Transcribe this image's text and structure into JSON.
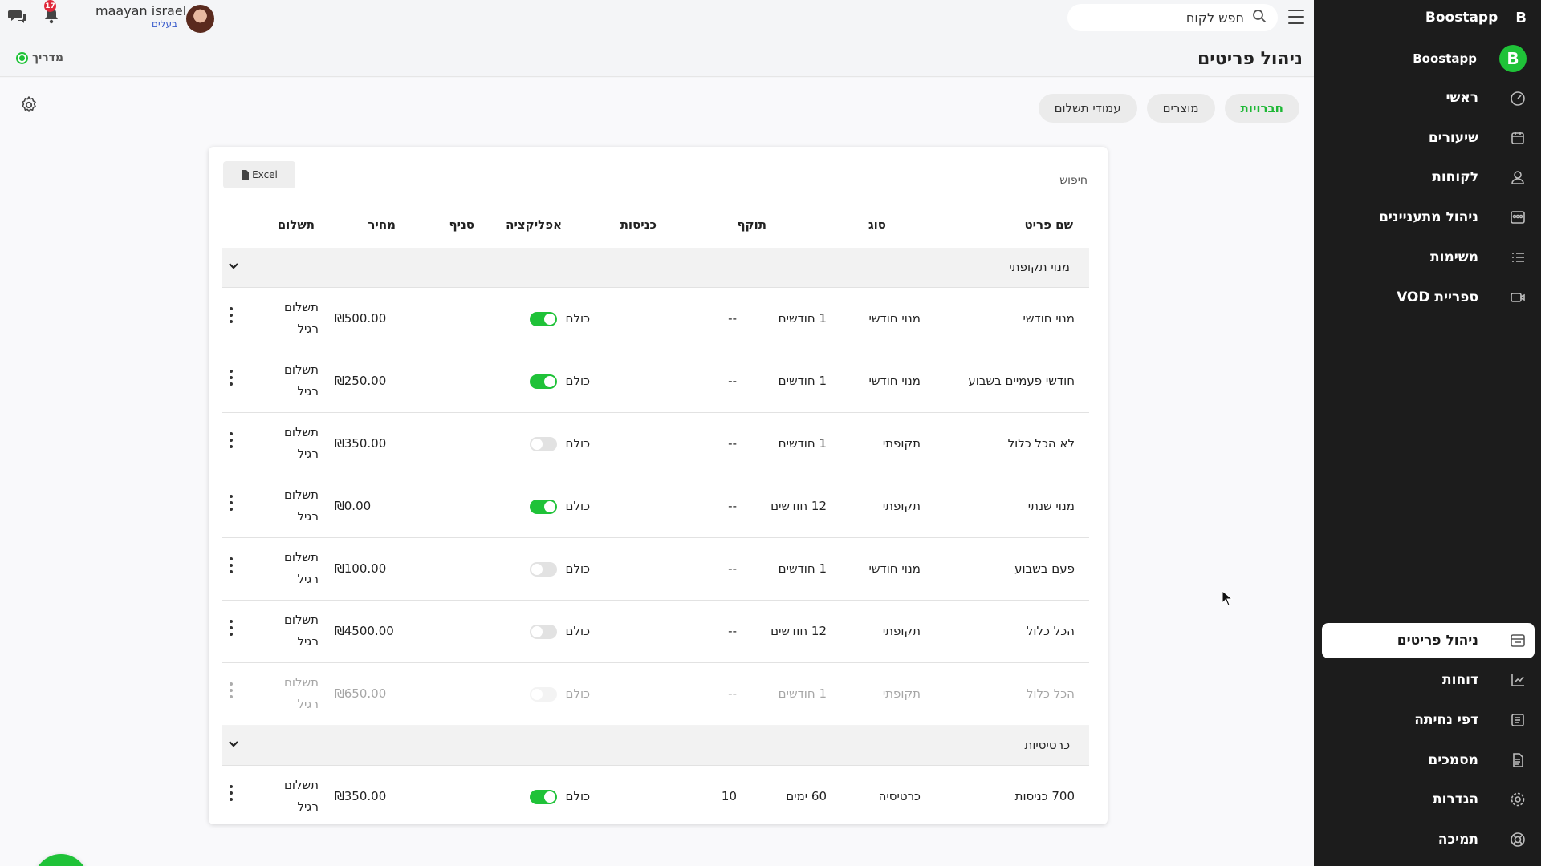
{
  "topbar": {
    "search_placeholder": "חפש לקוח",
    "notification_count": "17",
    "user_name": "maayan israel",
    "user_role": "בעלים"
  },
  "page": {
    "title": "ניהול פריטים",
    "guide_label": "מדריך"
  },
  "tabs": [
    {
      "label": "חברויות",
      "active": true
    },
    {
      "label": "מוצרים",
      "active": false
    },
    {
      "label": "עמודי תשלום",
      "active": false
    }
  ],
  "sidebar": {
    "brand": "Boostapp",
    "brand_mark": "B",
    "account": "Boostapp",
    "account_logo": "B",
    "items": [
      {
        "label": "ראשי",
        "icon": "dashboard-icon"
      },
      {
        "label": "שיעורים",
        "icon": "calendar-icon"
      },
      {
        "label": "לקוחות",
        "icon": "user-icon"
      },
      {
        "label": "ניהול מתעניינים",
        "icon": "leads-icon"
      },
      {
        "label": "משימות",
        "icon": "tasks-icon"
      },
      {
        "label": "ספריית VOD",
        "icon": "video-icon"
      },
      {
        "label": "ניהול פריטים",
        "icon": "store-icon",
        "active": true
      },
      {
        "label": "דוחות",
        "icon": "chart-icon"
      },
      {
        "label": "דפי נחיתה",
        "icon": "landing-icon"
      },
      {
        "label": "מסמכים",
        "icon": "document-icon"
      },
      {
        "label": "הגדרות",
        "icon": "gear-icon"
      },
      {
        "label": "תמיכה",
        "icon": "support-icon"
      }
    ]
  },
  "table": {
    "excel_label": "Excel",
    "search_label": "חיפוש",
    "headers": {
      "name": "שם פריט",
      "type": "סוג",
      "validity": "תוקף",
      "entries": "כניסות",
      "app": "אפליקציה",
      "branch": "סניף",
      "price": "מחיר",
      "payment": "תשלום"
    },
    "groups": [
      {
        "name": "מנוי תקופתי",
        "rows": [
          {
            "name": "מנוי חודשי",
            "type": "מנוי חודשי",
            "validity": "1 חודשים",
            "entries": "--",
            "app": true,
            "branch": "כולם",
            "price": "₪500.00",
            "payment": "תשלום רגיל",
            "dim": false
          },
          {
            "name": "חודשי פעמיים בשבוע",
            "type": "מנוי חודשי",
            "validity": "1 חודשים",
            "entries": "--",
            "app": true,
            "branch": "כולם",
            "price": "₪250.00",
            "payment": "תשלום רגיל",
            "dim": false
          },
          {
            "name": "לא הכל כלול",
            "type": "תקופתי",
            "validity": "1 חודשים",
            "entries": "--",
            "app": false,
            "branch": "כולם",
            "price": "₪350.00",
            "payment": "תשלום רגיל",
            "dim": false
          },
          {
            "name": "מנוי שנתי",
            "type": "תקופתי",
            "validity": "12 חודשים",
            "entries": "--",
            "app": true,
            "branch": "כולם",
            "price": "₪0.00",
            "payment": "תשלום רגיל",
            "dim": false
          },
          {
            "name": "פעם בשבוע",
            "type": "מנוי חודשי",
            "validity": "1 חודשים",
            "entries": "--",
            "app": false,
            "branch": "כולם",
            "price": "₪100.00",
            "payment": "תשלום רגיל",
            "dim": false
          },
          {
            "name": "הכל כלול",
            "type": "תקופתי",
            "validity": "12 חודשים",
            "entries": "--",
            "app": false,
            "branch": "כולם",
            "price": "₪4500.00",
            "payment": "תשלום רגיל",
            "dim": false
          },
          {
            "name": "הכל כלול",
            "type": "תקופתי",
            "validity": "1 חודשים",
            "entries": "--",
            "app": false,
            "branch": "כולם",
            "price": "₪650.00",
            "payment": "תשלום רגיל",
            "dim": true
          }
        ]
      },
      {
        "name": "כרטיסיות",
        "rows": [
          {
            "name": "700 כניסות",
            "type": "כרטיסיה",
            "validity": "60 ימים",
            "entries": "10",
            "app": true,
            "branch": "כולם",
            "price": "₪350.00",
            "payment": "תשלום רגיל",
            "dim": false
          }
        ]
      }
    ]
  },
  "colors": {
    "accent": "#1fc238",
    "sidebar_bg": "#1c1c1c",
    "badge": "#e0283a"
  }
}
